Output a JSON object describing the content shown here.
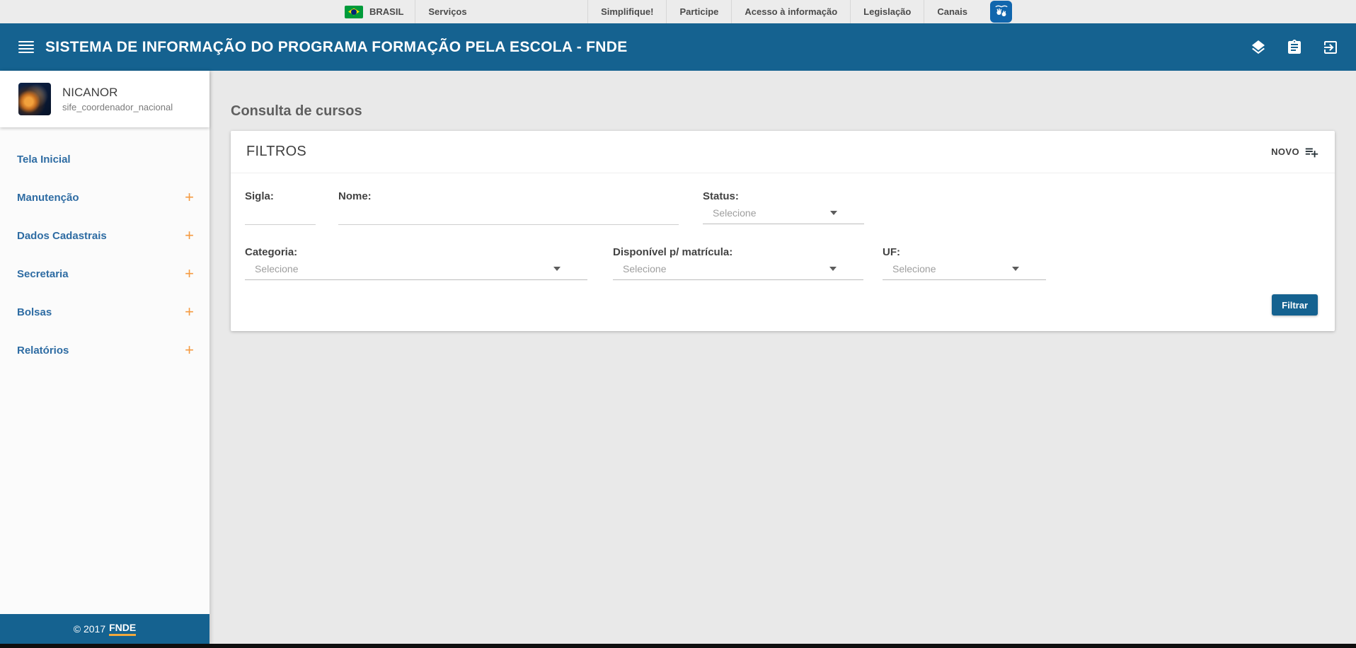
{
  "gov_bar": {
    "brand": "BRASIL",
    "servicos": "Serviços",
    "links": {
      "simplifique": "Simplifique!",
      "participe": "Participe",
      "acesso": "Acesso à informação",
      "legislacao": "Legislação",
      "canais": "Canais"
    }
  },
  "header": {
    "title": "SISTEMA DE INFORMAÇÃO DO PROGRAMA FORMAÇÃO PELA ESCOLA - FNDE"
  },
  "sidebar": {
    "user": {
      "name": "NICANOR",
      "role": "sife_coordenador_nacional"
    },
    "expand_glyph": "+",
    "items": [
      {
        "label": "Tela Inicial"
      },
      {
        "label": "Manutenção"
      },
      {
        "label": "Dados Cadastrais"
      },
      {
        "label": "Secretaria"
      },
      {
        "label": "Bolsas"
      },
      {
        "label": "Relatórios"
      }
    ],
    "footer": {
      "copyright": "© 2017",
      "brand": "FNDE"
    }
  },
  "main": {
    "page_title": "Consulta de cursos",
    "filters": {
      "title": "FILTROS",
      "novo_label": "NOVO",
      "sigla_label": "Sigla:",
      "sigla_value": "",
      "nome_label": "Nome:",
      "nome_value": "",
      "status_label": "Status:",
      "categoria_label": "Categoria:",
      "disponivel_label": "Disponível p/ matrícula:",
      "uf_label": "UF:",
      "select_placeholder": "Selecione",
      "filtrar_label": "Filtrar"
    }
  },
  "colors": {
    "primary_blue": "#156290",
    "accent_orange": "#f59b42",
    "underline_orange": "#f3a93c",
    "vlibras_blue": "#1166ad"
  }
}
